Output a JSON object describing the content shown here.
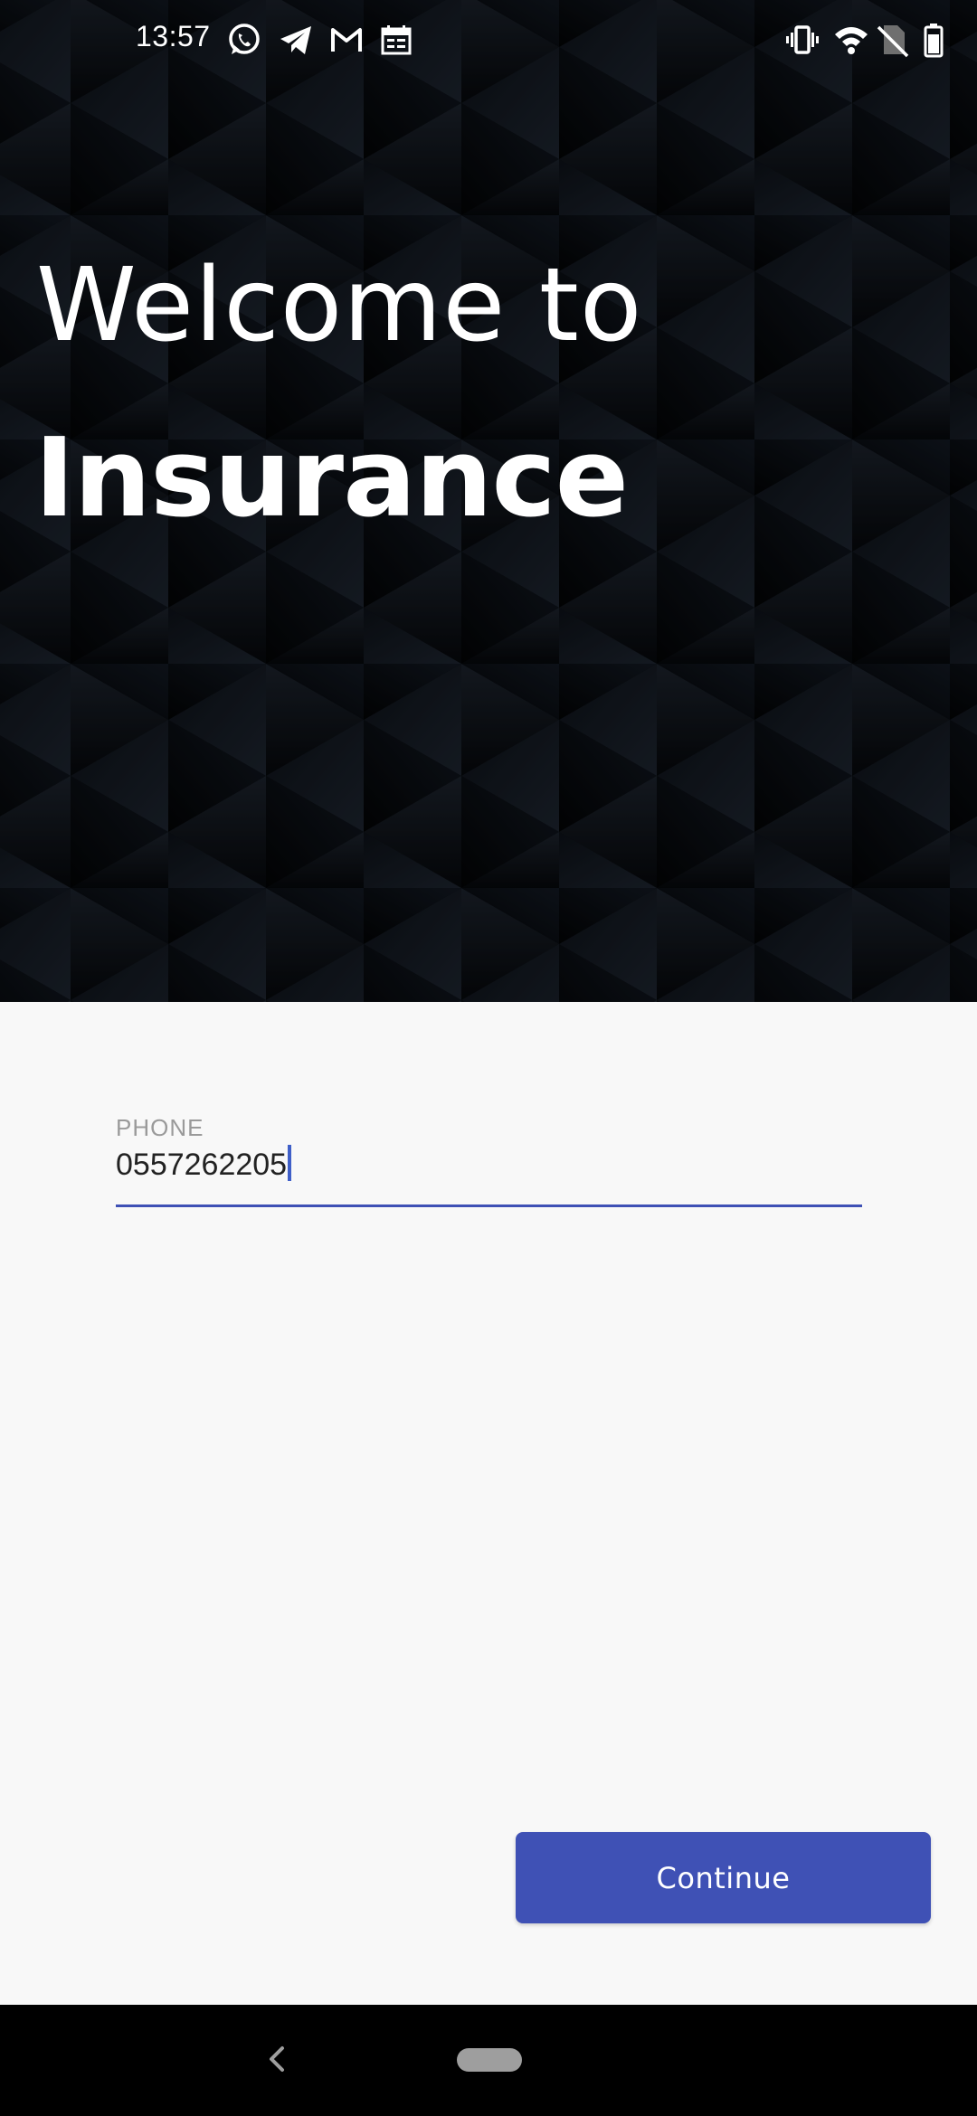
{
  "status_bar": {
    "time": "13:57",
    "icons_left": [
      "whatsapp-icon",
      "telegram-icon",
      "gmail-icon",
      "calendar-icon"
    ],
    "icons_right": [
      "vibrate-icon",
      "wifi-icon",
      "no-sim-icon",
      "battery-icon"
    ]
  },
  "hero": {
    "welcome_text": "Welcome to",
    "brand_text": "Insurance"
  },
  "form": {
    "phone_label": "PHONE",
    "phone_value": "0557262205"
  },
  "continue_label": "Continue",
  "colors": {
    "accent": "#3f51b5",
    "hero_background": "#07090d",
    "page_background": "#f8f8f8"
  }
}
